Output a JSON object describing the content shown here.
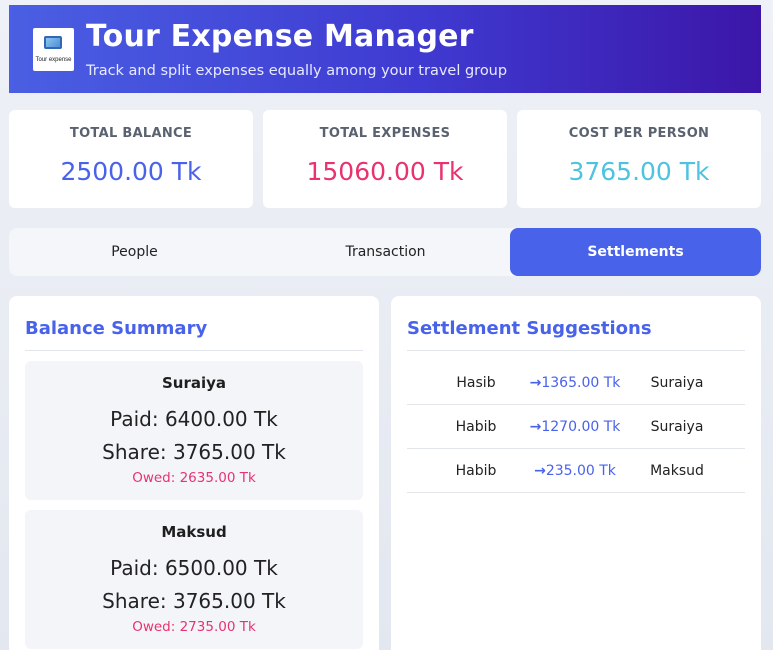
{
  "header": {
    "logo_text": "Tour expense",
    "title": "Tour Expense Manager",
    "subtitle": "Track and split expenses equally among your travel group"
  },
  "stats": [
    {
      "label": "TOTAL BALANCE",
      "value": "2500.00 Tk",
      "color": "#4962ea"
    },
    {
      "label": "TOTAL EXPENSES",
      "value": "15060.00 Tk",
      "color": "#e8336f"
    },
    {
      "label": "COST PER PERSON",
      "value": "3765.00 Tk",
      "color": "#4ec3e0"
    }
  ],
  "tabs": [
    {
      "label": "People",
      "active": false
    },
    {
      "label": "Transaction",
      "active": false
    },
    {
      "label": "Settlements",
      "active": true
    }
  ],
  "balance_summary": {
    "title": "Balance Summary",
    "people": [
      {
        "name": "Suraiya",
        "paid": "Paid: 6400.00 Tk",
        "share": "Share: 3765.00 Tk",
        "owed": "Owed: 2635.00 Tk"
      },
      {
        "name": "Maksud",
        "paid": "Paid: 6500.00 Tk",
        "share": "Share: 3765.00 Tk",
        "owed": "Owed: 2735.00 Tk"
      }
    ]
  },
  "settlements": {
    "title": "Settlement Suggestions",
    "arrow_icon": "arrow-right-icon",
    "rows": [
      {
        "from": "Hasib",
        "amount": "1365.00 Tk",
        "to": "Suraiya"
      },
      {
        "from": "Habib",
        "amount": "1270.00 Tk",
        "to": "Suraiya"
      },
      {
        "from": "Habib",
        "amount": "235.00 Tk",
        "to": "Maksud"
      }
    ]
  }
}
